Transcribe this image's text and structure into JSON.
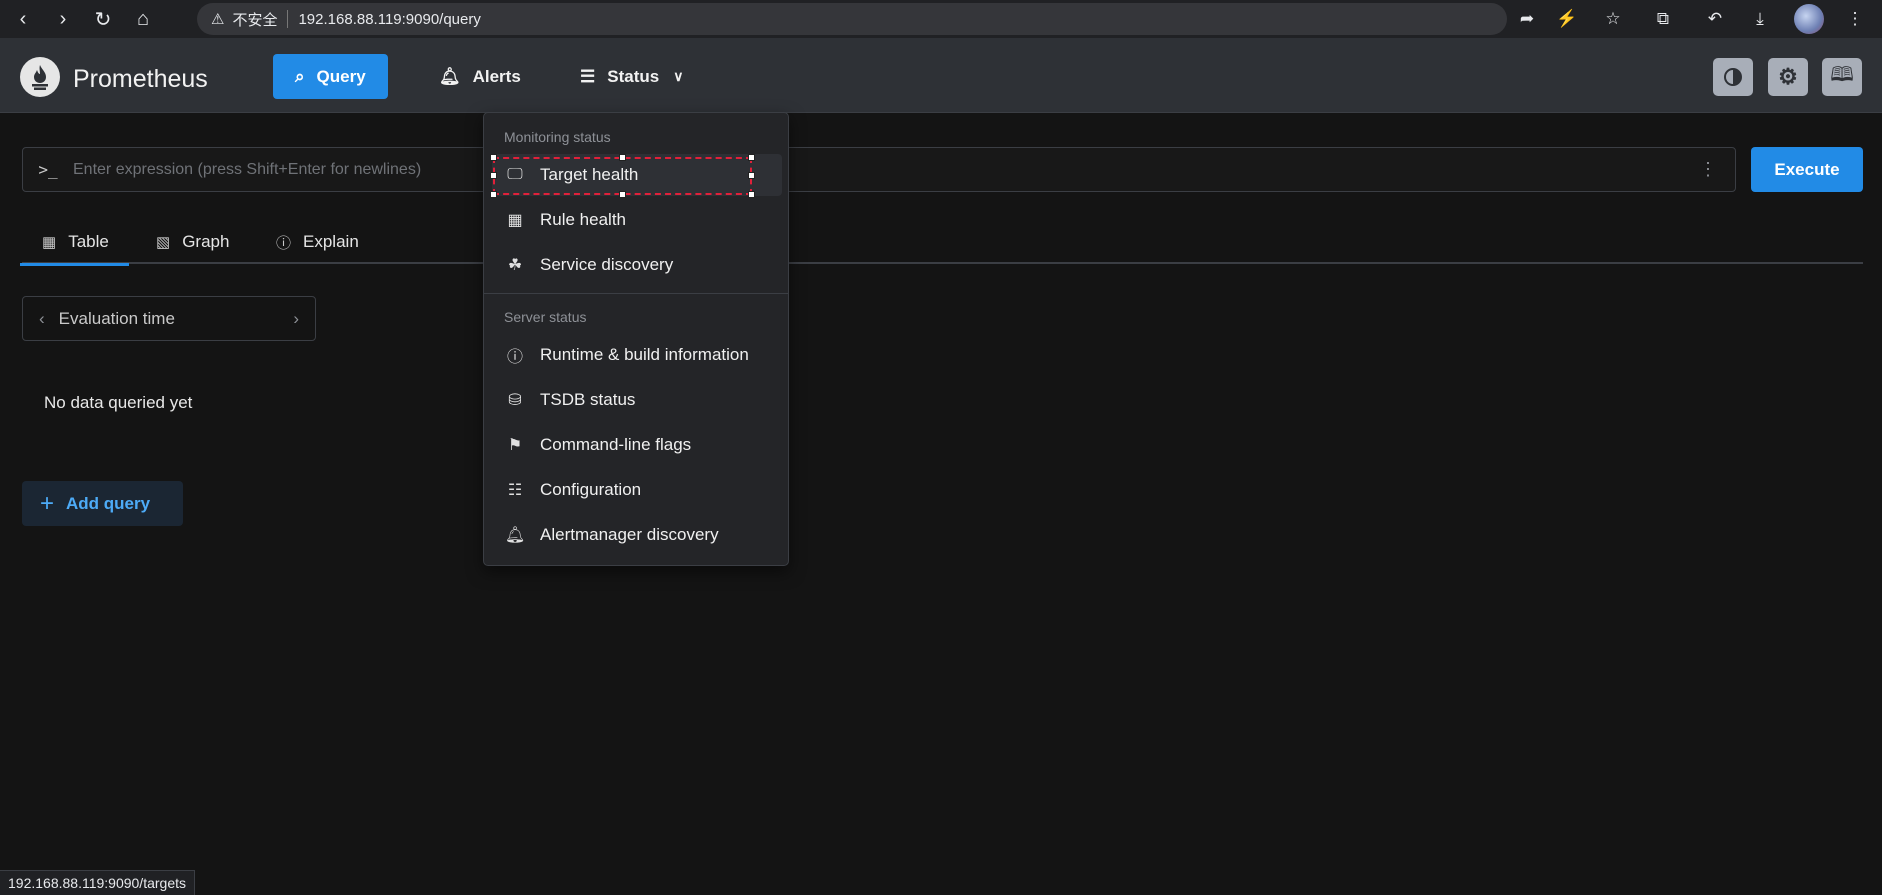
{
  "browser": {
    "insecure_label": "不安全",
    "url": "192.168.88.119:9090/query",
    "status_url": "192.168.88.119:9090/targets"
  },
  "app": {
    "brand": "Prometheus",
    "nav": {
      "query": "Query",
      "alerts": "Alerts",
      "status": "Status"
    }
  },
  "query": {
    "placeholder": "Enter expression (press Shift+Enter for newlines)",
    "execute": "Execute",
    "tabs": {
      "table": "Table",
      "graph": "Graph",
      "explain": "Explain"
    },
    "evaluation_time": "Evaluation time",
    "no_data": "No data queried yet",
    "add_query": "Add query"
  },
  "status_menu": {
    "monitoring_label": "Monitoring status",
    "server_label": "Server status",
    "items": [
      {
        "label": "Target health",
        "icon": "target-icon"
      },
      {
        "label": "Rule health",
        "icon": "table-icon"
      },
      {
        "label": "Service discovery",
        "icon": "sitemap-icon"
      },
      {
        "label": "Runtime & build information",
        "icon": "info-icon"
      },
      {
        "label": "TSDB status",
        "icon": "database-icon"
      },
      {
        "label": "Command-line flags",
        "icon": "flag-icon"
      },
      {
        "label": "Configuration",
        "icon": "server-cog-icon"
      },
      {
        "label": "Alertmanager discovery",
        "icon": "bell-icon"
      }
    ]
  },
  "colors": {
    "accent": "#228be6",
    "background": "#141414",
    "header": "#2e3136",
    "selection": "#e0203a"
  }
}
